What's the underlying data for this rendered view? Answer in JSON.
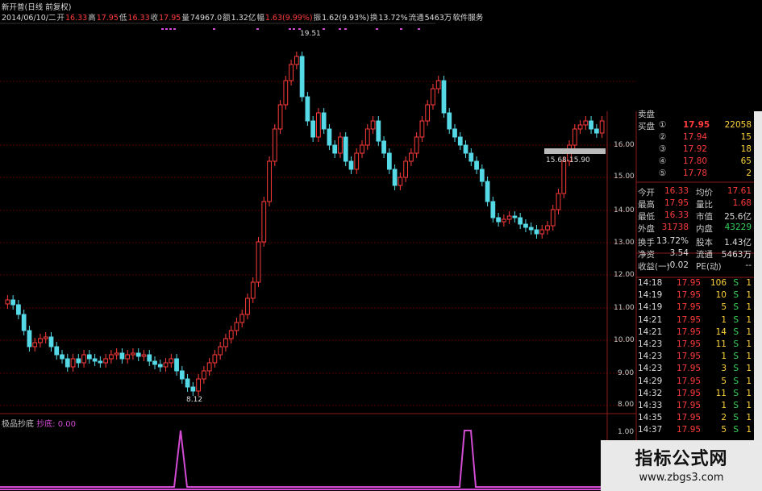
{
  "header": {
    "title": "新开普(日线 前复权)",
    "date_prefix": "2014/06/10/二",
    "open_label": "开",
    "open": "16.33",
    "high_label": "高",
    "high": "17.95",
    "low_label": "低",
    "low": "16.33",
    "close_label": "收",
    "close": "17.95",
    "vol_label": "量",
    "vol": "74967.0",
    "amt_label": "额",
    "amt": "1.32亿",
    "chg_label": "幅",
    "chg": "1.63(9.99%)",
    "amp_label": "振",
    "amp": "1.62(9.93%)",
    "turn_label": "换",
    "turn": "13.72%",
    "float_label": "流通",
    "float": "5463万",
    "service": "软件服务"
  },
  "price_axis": [
    "16.00",
    "15.00",
    "14.00",
    "13.00",
    "12.00",
    "11.00",
    "10.00",
    "9.00",
    "8.00",
    "1.00"
  ],
  "annotations": {
    "high_marker": "19.51",
    "low_marker": "8.12",
    "range_box": "15.68-15.90"
  },
  "indicator": {
    "name": "极品抄底",
    "param": "抄底: 0.00"
  },
  "panel": {
    "sell_header": "卖盘",
    "buy_header": "买盘",
    "bids": [
      {
        "n": "①",
        "price": "17.95",
        "vol": "22058"
      },
      {
        "n": "②",
        "price": "17.94",
        "vol": "15"
      },
      {
        "n": "③",
        "price": "17.92",
        "vol": "18"
      },
      {
        "n": "④",
        "price": "17.80",
        "vol": "65"
      },
      {
        "n": "⑤",
        "price": "17.78",
        "vol": "2"
      }
    ],
    "stats": [
      {
        "l1": "今开",
        "v1": "16.33",
        "l2": "均价",
        "v2": "17.61",
        "c1": "red",
        "c2": "red"
      },
      {
        "l1": "最高",
        "v1": "17.95",
        "l2": "量比",
        "v2": "1.68",
        "c1": "red",
        "c2": "red"
      },
      {
        "l1": "最低",
        "v1": "16.33",
        "l2": "市值",
        "v2": "25.6亿",
        "c1": "red",
        "c2": "white"
      },
      {
        "l1": "外盘",
        "v1": "31738",
        "l2": "内盘",
        "v2": "43229",
        "c1": "red",
        "c2": "green"
      },
      {
        "l1": "换手",
        "v1": "13.72%",
        "l2": "股本",
        "v2": "1.43亿",
        "c1": "white",
        "c2": "white"
      },
      {
        "l1": "净资",
        "v1": "3.54",
        "l2": "流通",
        "v2": "5463万",
        "c1": "white",
        "c2": "white"
      },
      {
        "l1": "收益(一)",
        "v1": "-0.02",
        "l2": "PE(动)",
        "v2": "--",
        "c1": "white",
        "c2": "white"
      }
    ],
    "ticks": [
      {
        "t": "14:18",
        "p": "17.95",
        "v": "106",
        "s": "S",
        "x": "1"
      },
      {
        "t": "14:19",
        "p": "17.95",
        "v": "10",
        "s": "S",
        "x": "1"
      },
      {
        "t": "14:19",
        "p": "17.95",
        "v": "5",
        "s": "S",
        "x": "1"
      },
      {
        "t": "14:21",
        "p": "17.95",
        "v": "1",
        "s": "S",
        "x": "1"
      },
      {
        "t": "14:21",
        "p": "17.95",
        "v": "14",
        "s": "S",
        "x": "1"
      },
      {
        "t": "14:23",
        "p": "17.95",
        "v": "11",
        "s": "S",
        "x": "1"
      },
      {
        "t": "14:23",
        "p": "17.95",
        "v": "1",
        "s": "S",
        "x": "1"
      },
      {
        "t": "14:23",
        "p": "17.95",
        "v": "3",
        "s": "S",
        "x": "1"
      },
      {
        "t": "14:29",
        "p": "17.95",
        "v": "5",
        "s": "S",
        "x": "1"
      },
      {
        "t": "14:32",
        "p": "17.95",
        "v": "11",
        "s": "S",
        "x": "1"
      },
      {
        "t": "14:33",
        "p": "17.95",
        "v": "1",
        "s": "S",
        "x": "1"
      },
      {
        "t": "14:35",
        "p": "17.95",
        "v": "2",
        "s": "S",
        "x": "1"
      },
      {
        "t": "14:37",
        "p": "17.95",
        "v": "5",
        "s": "S",
        "x": "1"
      }
    ]
  },
  "colors": {
    "up": "#ff3b3b",
    "down": "#55d9e6",
    "indicator": "#d24bd2",
    "grid": "#5a0000"
  },
  "watermark": {
    "title": "指标公式网",
    "url": "www.zbgs3.com"
  }
}
